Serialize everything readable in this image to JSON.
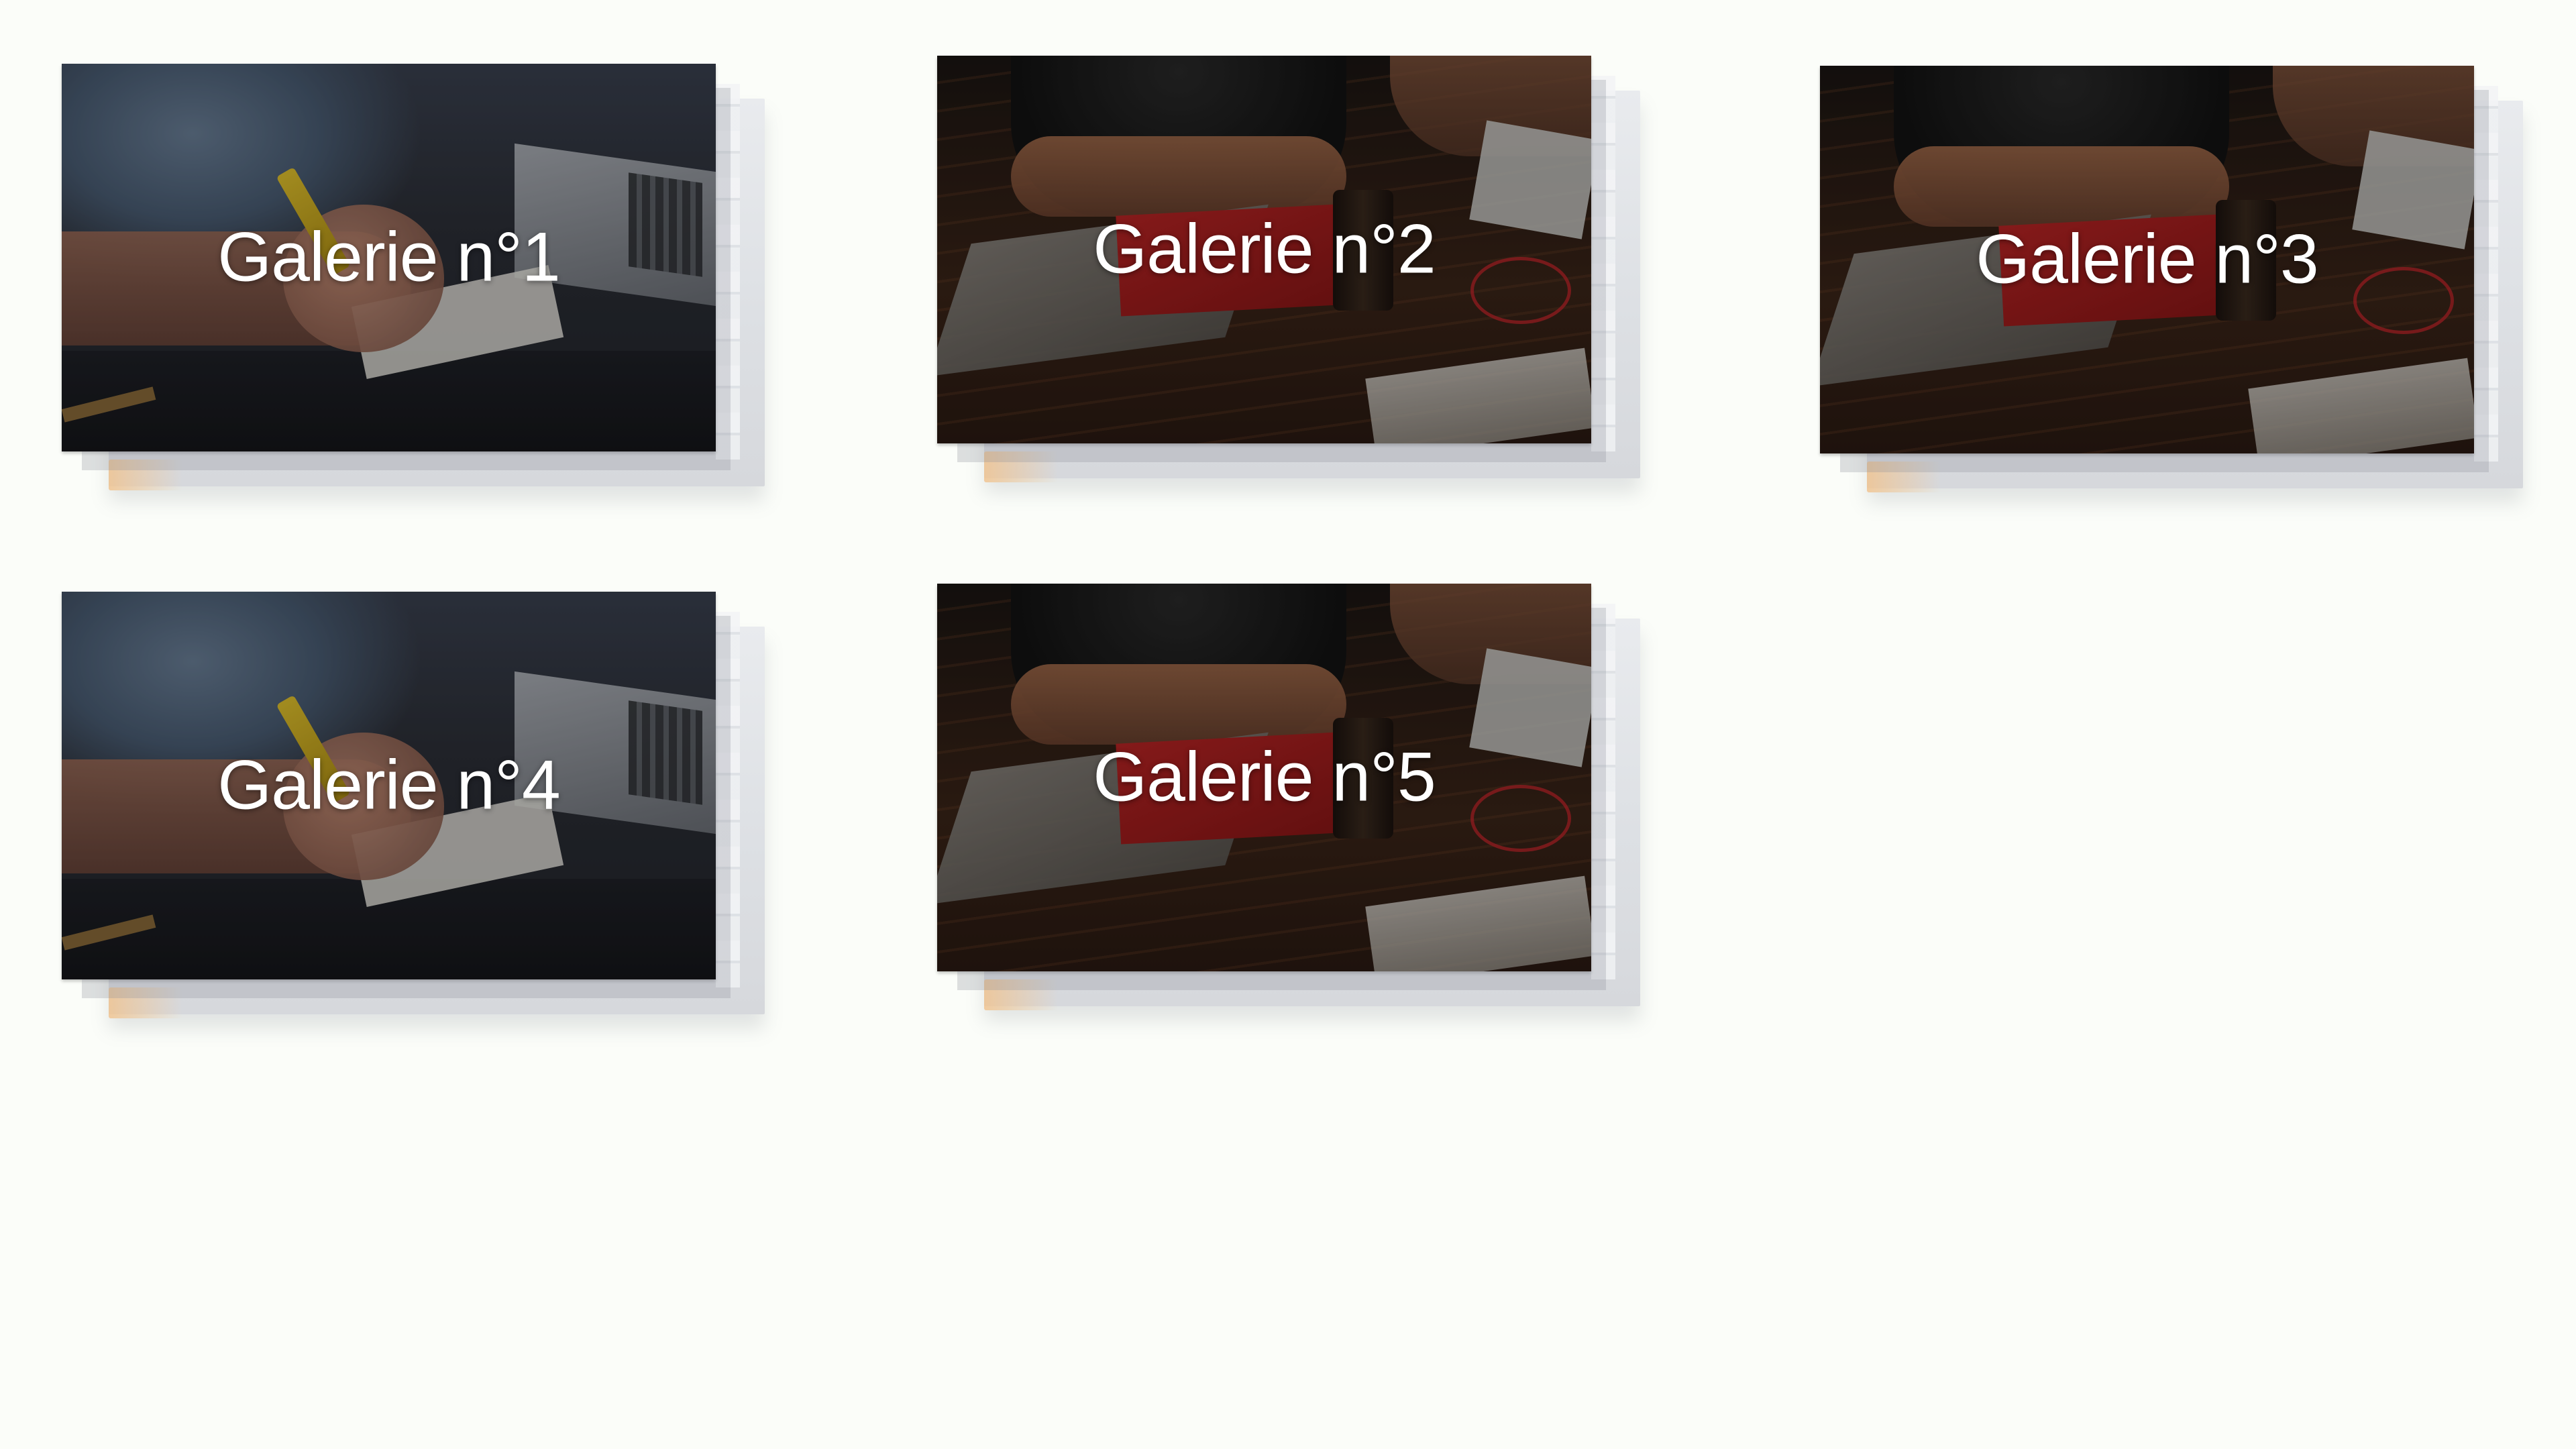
{
  "gallery": {
    "items": [
      {
        "title": "Galerie n°1",
        "photo": "man-writing-desk"
      },
      {
        "title": "Galerie n°2",
        "photo": "team-wooden-table"
      },
      {
        "title": "Galerie n°3",
        "photo": "team-wooden-table"
      },
      {
        "title": "Galerie n°4",
        "photo": "man-writing-desk"
      },
      {
        "title": "Galerie n°5",
        "photo": "team-wooden-table"
      }
    ]
  },
  "colors": {
    "page_background": "#fbfdf9",
    "title_text": "#ffffff",
    "stack_shadow": "#dde0e4",
    "accent_peach": "#f0c491"
  }
}
